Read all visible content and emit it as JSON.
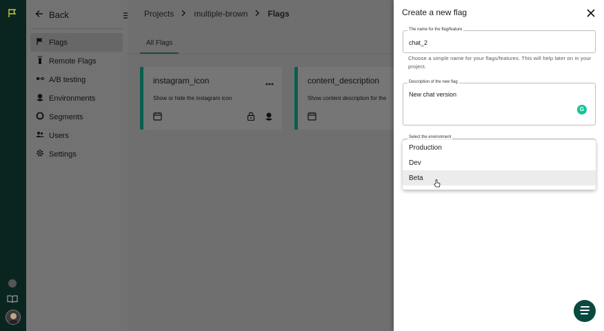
{
  "sidebar": {
    "back_label": "Back",
    "items": [
      {
        "label": "Flags",
        "icon": "flag-icon",
        "active": true
      },
      {
        "label": "Remote Flags",
        "icon": "remote-icon",
        "active": false
      },
      {
        "label": "A/B testing",
        "icon": "ab-test-icon",
        "active": false
      },
      {
        "label": "Environments",
        "icon": "environments-icon",
        "active": false
      },
      {
        "label": "Segments",
        "icon": "segments-icon",
        "active": false
      },
      {
        "label": "Users",
        "icon": "users-icon",
        "active": false
      },
      {
        "label": "Settings",
        "icon": "settings-icon",
        "active": false
      }
    ]
  },
  "breadcrumb": {
    "project_root": "Projects",
    "project": "multiple-brown",
    "current": "Flags"
  },
  "tabs": [
    {
      "label": "All Flags",
      "active": true
    }
  ],
  "cards": [
    {
      "title": "instagram_icon",
      "description": "Show or hide the instagram icon"
    },
    {
      "title": "content_description",
      "description": "Show content description for the"
    }
  ],
  "panel": {
    "title": "Create a new flag",
    "name_field": {
      "label": "The name for the flag/feature",
      "value": "chat_2",
      "hint": "Choose a simple name for your flags/features. This will help later on in your project."
    },
    "description_field": {
      "label": "Description of the new flag",
      "value": "New chat version"
    },
    "environment_field": {
      "label": "Select the environment",
      "options": [
        "Production",
        "Dev",
        "Beta"
      ],
      "hovered": "Beta"
    }
  },
  "colors": {
    "rail": "#0a2520",
    "accent": "#0a5e4d",
    "chat_fab": "#0a4a3e",
    "grammarly": "#15c39a"
  }
}
